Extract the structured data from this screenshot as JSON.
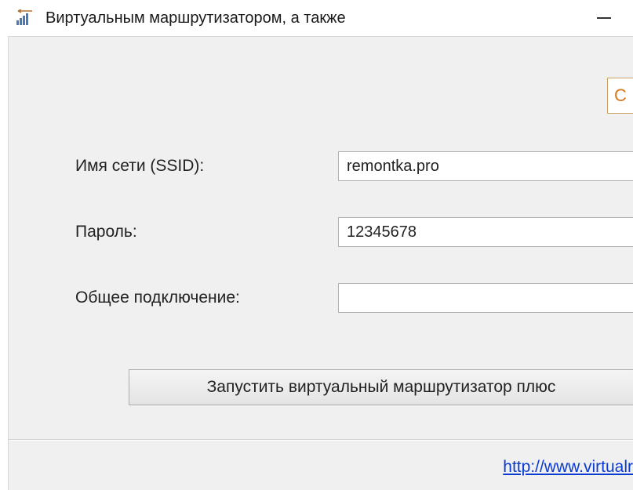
{
  "window": {
    "title": "Виртуальным маршрутизатором, а также"
  },
  "top_button": {
    "label_fragment": "С"
  },
  "form": {
    "ssid_label": "Имя сети (SSID):",
    "ssid_value": "remontka.pro",
    "password_label": "Пароль:",
    "password_value": "12345678",
    "shared_label": "Общее подключение:",
    "shared_value": ""
  },
  "start_button": {
    "label": "Запустить виртуальный маршрутизатор плюс"
  },
  "footer": {
    "link_text": "http://www.virtualr"
  }
}
